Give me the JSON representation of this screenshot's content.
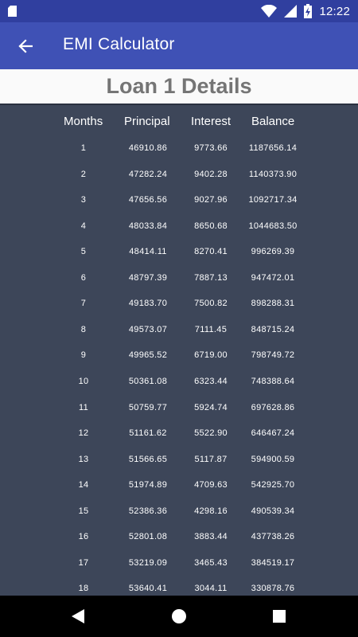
{
  "status_bar": {
    "time": "12:22",
    "icons": [
      "sd-card-icon",
      "wifi-icon",
      "cellular-signal-icon",
      "battery-charging-icon"
    ]
  },
  "app_bar": {
    "title": "EMI Calculator",
    "back_icon": "arrow-back-icon"
  },
  "details": {
    "title": "Loan 1 Details"
  },
  "table": {
    "headers": [
      "Months",
      "Principal",
      "Interest",
      "Balance"
    ],
    "rows": [
      [
        "1",
        "46910.86",
        "9773.66",
        "1187656.14"
      ],
      [
        "2",
        "47282.24",
        "9402.28",
        "1140373.90"
      ],
      [
        "3",
        "47656.56",
        "9027.96",
        "1092717.34"
      ],
      [
        "4",
        "48033.84",
        "8650.68",
        "1044683.50"
      ],
      [
        "5",
        "48414.11",
        "8270.41",
        "996269.39"
      ],
      [
        "6",
        "48797.39",
        "7887.13",
        "947472.01"
      ],
      [
        "7",
        "49183.70",
        "7500.82",
        "898288.31"
      ],
      [
        "8",
        "49573.07",
        "7111.45",
        "848715.24"
      ],
      [
        "9",
        "49965.52",
        "6719.00",
        "798749.72"
      ],
      [
        "10",
        "50361.08",
        "6323.44",
        "748388.64"
      ],
      [
        "11",
        "50759.77",
        "5924.74",
        "697628.86"
      ],
      [
        "12",
        "51161.62",
        "5522.90",
        "646467.24"
      ],
      [
        "13",
        "51566.65",
        "5117.87",
        "594900.59"
      ],
      [
        "14",
        "51974.89",
        "4709.63",
        "542925.70"
      ],
      [
        "15",
        "52386.36",
        "4298.16",
        "490539.34"
      ],
      [
        "16",
        "52801.08",
        "3883.44",
        "437738.26"
      ],
      [
        "17",
        "53219.09",
        "3465.43",
        "384519.17"
      ],
      [
        "18",
        "53640.41",
        "3044.11",
        "330878.76"
      ]
    ]
  },
  "nav_bar": {
    "icons": [
      "back-triangle-icon",
      "home-circle-icon",
      "recents-square-icon"
    ]
  },
  "colors": {
    "status_bar": "#303f9f",
    "app_bar": "#3f51b5",
    "table_background": "#3d4659",
    "details_title": "#757575",
    "header_background": "#fafafa"
  }
}
